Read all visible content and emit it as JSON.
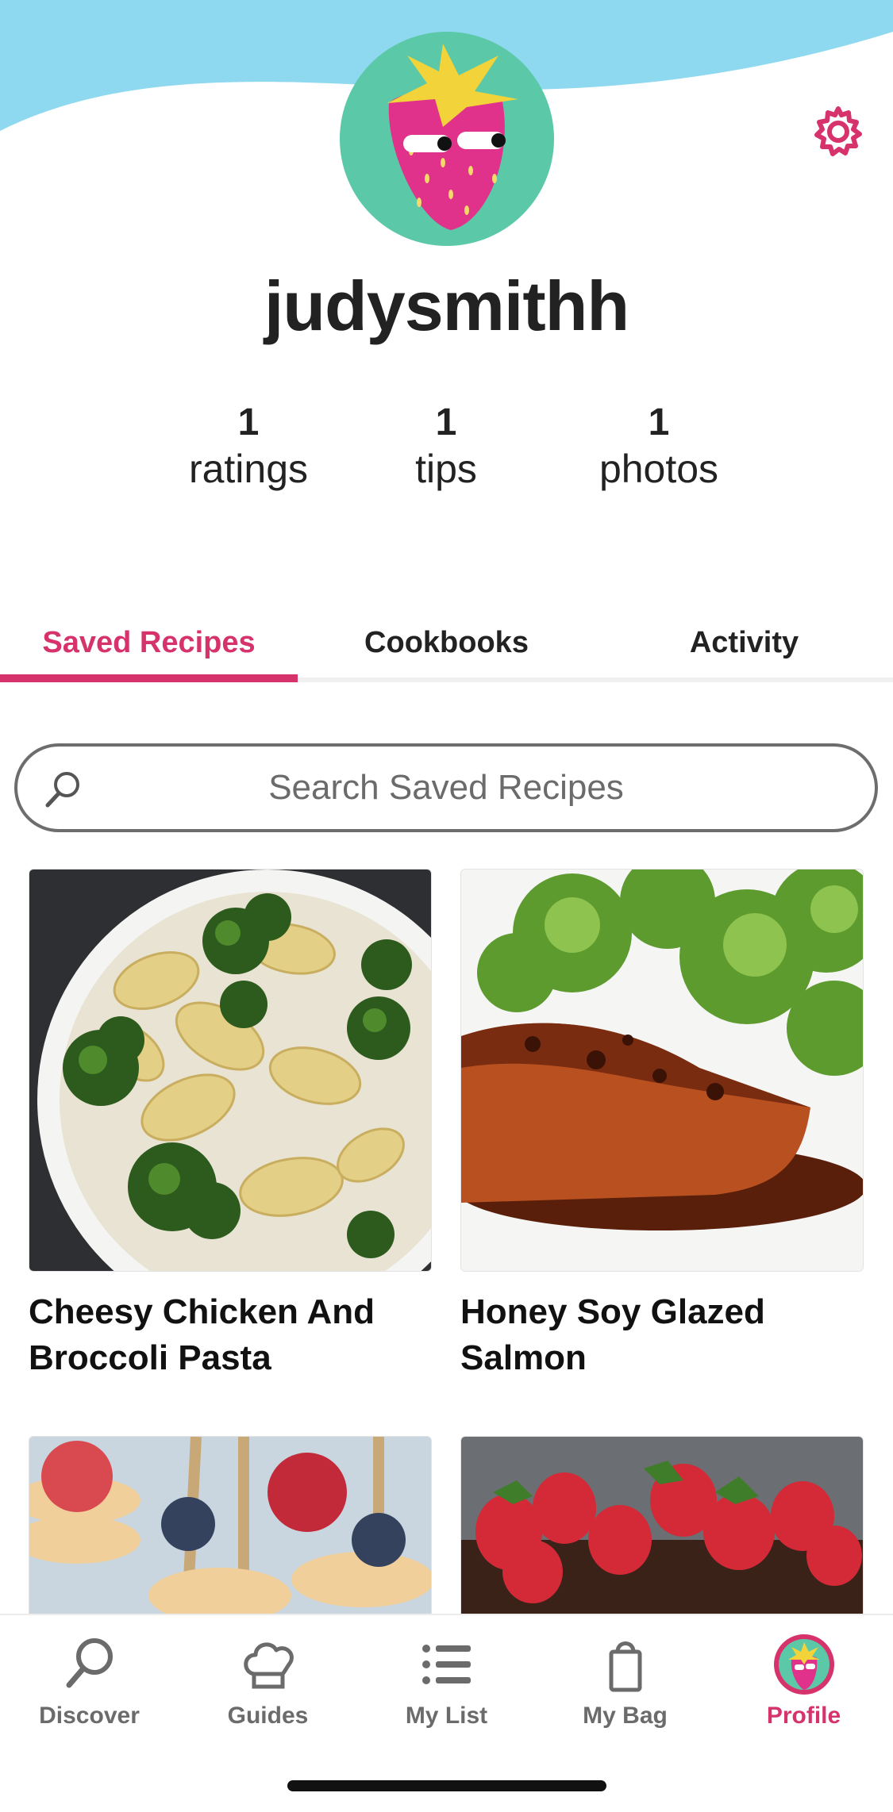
{
  "header": {
    "username": "judysmithh",
    "settings_icon": "gear-icon",
    "avatar_icon": "strawberry-avatar",
    "colors": {
      "sky": "#8ed9ef",
      "accent": "#d6336c",
      "avatar_bg": "#5bc9a8"
    }
  },
  "stats": [
    {
      "value": "1",
      "label": "ratings"
    },
    {
      "value": "1",
      "label": "tips"
    },
    {
      "value": "1",
      "label": "photos"
    }
  ],
  "tabs": [
    {
      "label": "Saved Recipes",
      "active": true
    },
    {
      "label": "Cookbooks",
      "active": false
    },
    {
      "label": "Activity",
      "active": false
    }
  ],
  "search": {
    "placeholder": "Search Saved Recipes",
    "value": ""
  },
  "recipes": [
    {
      "title": "Cheesy Chicken And Broccoli Pasta",
      "image": "pasta-broccoli-photo"
    },
    {
      "title": "Honey Soy Glazed Salmon",
      "image": "glazed-salmon-photo"
    },
    {
      "title": "",
      "image": "pancake-skewers-photo"
    },
    {
      "title": "",
      "image": "strawberry-chocolate-cake-photo"
    }
  ],
  "bottom_nav": [
    {
      "label": "Discover",
      "icon": "search-icon",
      "active": false
    },
    {
      "label": "Guides",
      "icon": "chef-hat-icon",
      "active": false
    },
    {
      "label": "My List",
      "icon": "list-icon",
      "active": false
    },
    {
      "label": "My Bag",
      "icon": "bag-icon",
      "active": false
    },
    {
      "label": "Profile",
      "icon": "profile-avatar-icon",
      "active": true
    }
  ]
}
